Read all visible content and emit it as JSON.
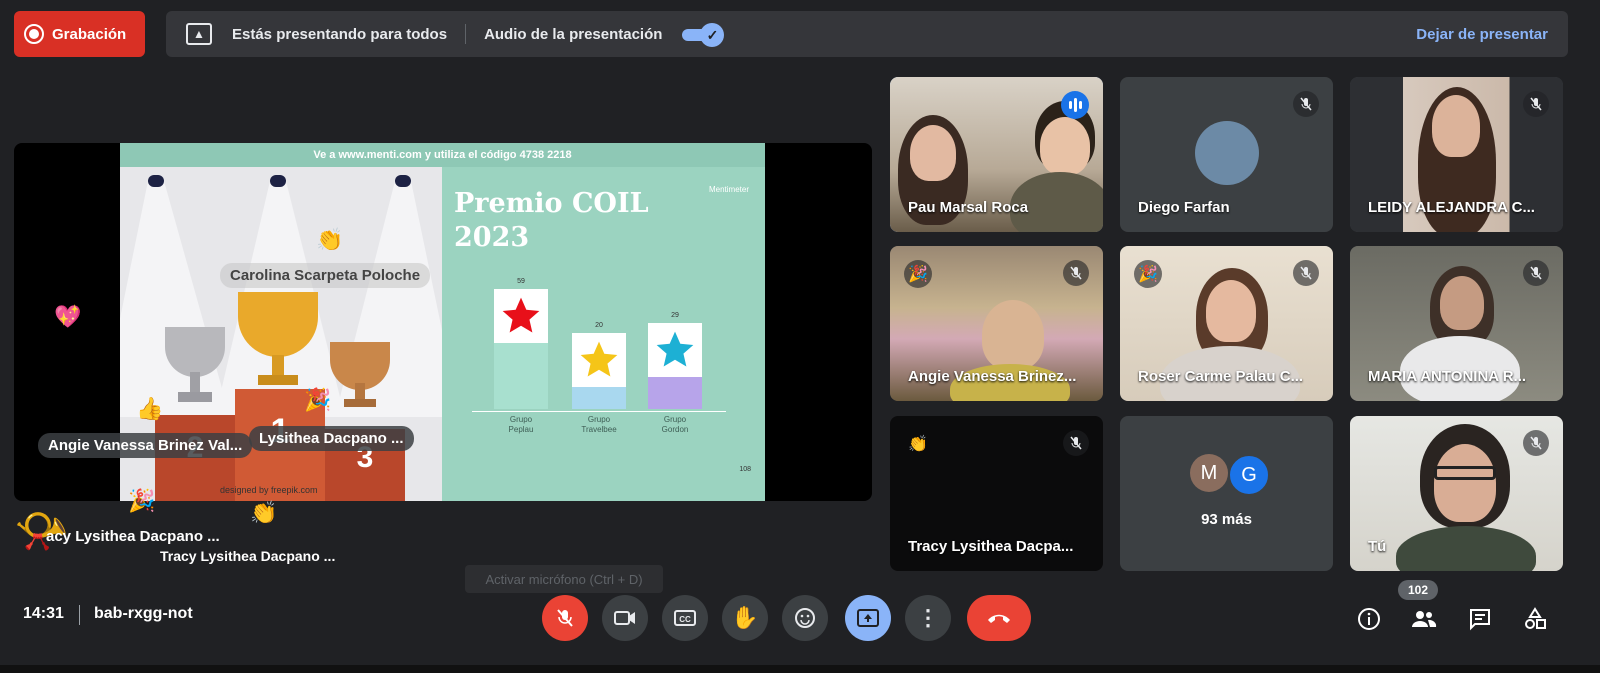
{
  "recording": {
    "label": "Grabación"
  },
  "presenting": {
    "status": "Estás presentando para todos",
    "audio_label": "Audio de la presentación",
    "audio_enabled": true,
    "stop_label": "Dejar de presentar"
  },
  "slide": {
    "header": "Ve a www.menti.com y utiliza el código 4738 2218",
    "title_line1": "Premio COIL",
    "title_line2": "2023",
    "brand": "Mentimeter",
    "winner": "Carolina Scarpeta Poloche",
    "credit": "designed by freepik.com",
    "slide_number": "108",
    "podium_numbers": [
      "2",
      "1",
      "3"
    ]
  },
  "chart_data": {
    "type": "bar",
    "categories": [
      "Grupo Peplau",
      "Grupo Travelbee",
      "Grupo Gordon"
    ],
    "values": [
      59,
      20,
      29
    ],
    "series_colors": [
      "#a8e0cf",
      "#a9d8ef",
      "#b7a4ea"
    ]
  },
  "stage_names": {
    "name1": "Angie Vanessa Brinez Val...",
    "name2": "Lysithea Dacpano ...",
    "name3": "acy Lysithea Dacpano ...",
    "name4": "Tracy Lysithea Dacpano ..."
  },
  "participants": [
    {
      "name": "Pau Marsal Roca",
      "speaking": true
    },
    {
      "name": "Diego Farfan",
      "muted": true
    },
    {
      "name": "LEIDY ALEJANDRA C...",
      "muted": true
    },
    {
      "name": "Angie Vanessa Brinez...",
      "muted": true
    },
    {
      "name": "Roser Carme Palau C...",
      "muted": true
    },
    {
      "name": "MARIA ANTONINA R...",
      "muted": true
    },
    {
      "name": "Tracy Lysithea Dacpa...",
      "muted": true
    },
    {
      "more_initials": [
        "M",
        "G"
      ],
      "more_label": "93 más"
    },
    {
      "name": "Tú",
      "muted": true
    }
  ],
  "bottom": {
    "time": "14:31",
    "meeting_code": "bab-rxgg-not",
    "mic_tooltip": "Activar micrófono (Ctrl + D)",
    "participant_count": "102"
  },
  "colors": {
    "accent": "#8ab4f8",
    "danger": "#ea4335",
    "background": "#202124"
  }
}
